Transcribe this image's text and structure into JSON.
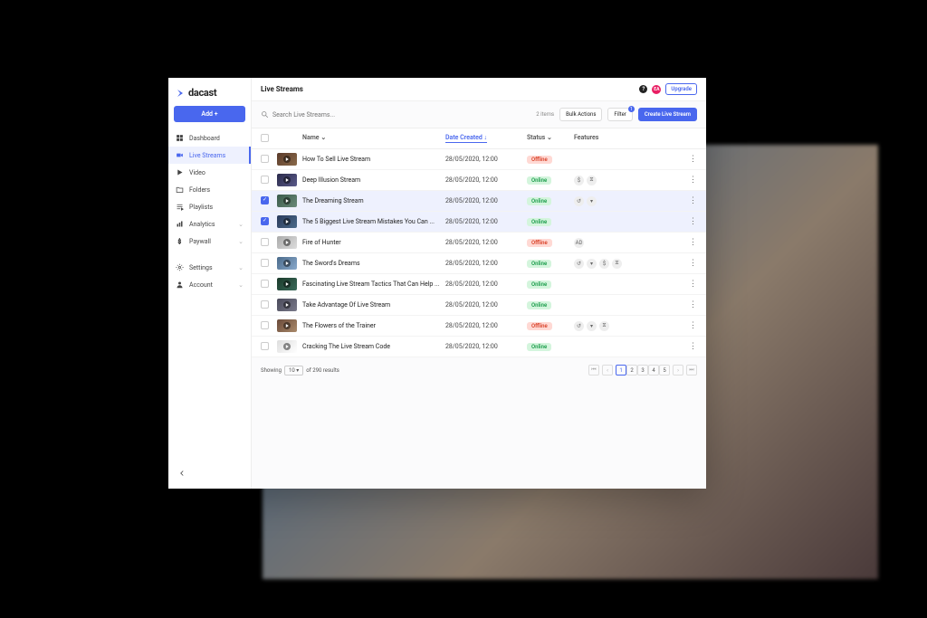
{
  "brand": {
    "name": "dacast"
  },
  "sidebar": {
    "add_label": "Add +",
    "items": [
      {
        "label": "Dashboard",
        "icon": "dashboard-icon"
      },
      {
        "label": "Live Streams",
        "icon": "camera-icon",
        "active": true
      },
      {
        "label": "Video",
        "icon": "play-icon"
      },
      {
        "label": "Folders",
        "icon": "folder-icon"
      },
      {
        "label": "Playlists",
        "icon": "playlist-icon"
      },
      {
        "label": "Analytics",
        "icon": "chart-icon",
        "expandable": true
      },
      {
        "label": "Paywall",
        "icon": "dollar-icon",
        "expandable": true
      }
    ],
    "settings_label": "Settings",
    "account_label": "Account"
  },
  "header": {
    "title": "Live Streams",
    "avatar_initials": "EA",
    "upgrade_label": "Upgrade"
  },
  "toolbar": {
    "search_placeholder": "Search Live Streams...",
    "items_count": "2 items",
    "bulk_actions_label": "Bulk Actions",
    "filter_label": "Filter",
    "filter_badge": "1",
    "create_label": "Create Live Stream"
  },
  "table": {
    "columns": {
      "name": "Name",
      "date": "Date Created",
      "status": "Status",
      "features": "Features"
    },
    "status_labels": {
      "online": "Online",
      "offline": "Offline"
    },
    "rows": [
      {
        "name": "How To Sell Live Stream",
        "date": "28/05/2020, 12:00",
        "status": "offline",
        "features": [],
        "thumb": "t1"
      },
      {
        "name": "Deep Illusion Stream",
        "date": "28/05/2020, 12:00",
        "status": "online",
        "features": [
          "$",
          "⧖"
        ],
        "thumb": "t2"
      },
      {
        "name": "The Dreaming Stream",
        "date": "28/05/2020, 12:00",
        "status": "online",
        "features": [
          "↺",
          "▾"
        ],
        "selected": true,
        "thumb": "t3"
      },
      {
        "name": "The 5 Biggest Live Stream Mistakes You Can ...",
        "date": "28/05/2020, 12:00",
        "status": "online",
        "features": [],
        "selected": true,
        "thumb": "t4"
      },
      {
        "name": "Fire of Hunter",
        "date": "28/05/2020, 12:00",
        "status": "offline",
        "features": [
          "AD"
        ],
        "thumb": "t5"
      },
      {
        "name": "The Sword's Dreams",
        "date": "28/05/2020, 12:00",
        "status": "online",
        "features": [
          "↺",
          "▾",
          "$",
          "⧖"
        ],
        "thumb": "t6"
      },
      {
        "name": "Fascinating Live Stream Tactics That Can Help ...",
        "date": "28/05/2020, 12:00",
        "status": "online",
        "features": [],
        "thumb": "t7"
      },
      {
        "name": "Take Advantage Of Live Stream",
        "date": "28/05/2020, 12:00",
        "status": "online",
        "features": [],
        "thumb": "t8"
      },
      {
        "name": "The Flowers of the Trainer",
        "date": "28/05/2020, 12:00",
        "status": "offline",
        "features": [
          "↺",
          "▾",
          "⧖"
        ],
        "thumb": "t9"
      },
      {
        "name": "Cracking The Live Stream Code",
        "date": "28/05/2020, 12:00",
        "status": "online",
        "features": [],
        "thumb": "t10"
      }
    ]
  },
  "pagination": {
    "showing_label": "Showing",
    "per_page": "10",
    "of_results": "of 290 results",
    "pages": [
      "1",
      "2",
      "3",
      "4",
      "5"
    ],
    "current": "1"
  }
}
